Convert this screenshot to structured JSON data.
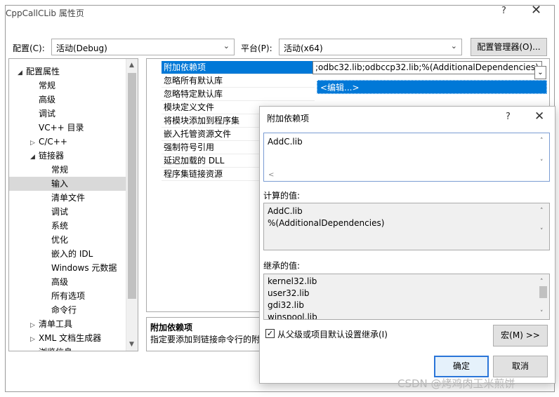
{
  "window": {
    "title": "CppCallCLib 属性页",
    "help": "?",
    "close": "✕"
  },
  "toolbar": {
    "config_label": "配置(C):",
    "config_value": "活动(Debug)",
    "platform_label": "平台(P):",
    "platform_value": "活动(x64)",
    "config_manager": "配置管理器(O)..."
  },
  "tree": {
    "items": [
      {
        "label": "配置属性",
        "arrow": "◢"
      },
      {
        "label": "常规"
      },
      {
        "label": "高级"
      },
      {
        "label": "调试"
      },
      {
        "label": "VC++ 目录"
      },
      {
        "label": "C/C++",
        "arrow": "▷"
      },
      {
        "label": "链接器",
        "arrow": "◢"
      },
      {
        "label": "常规"
      },
      {
        "label": "输入"
      },
      {
        "label": "清单文件"
      },
      {
        "label": "调试"
      },
      {
        "label": "系统"
      },
      {
        "label": "优化"
      },
      {
        "label": "嵌入的 IDL"
      },
      {
        "label": "Windows 元数据"
      },
      {
        "label": "高级"
      },
      {
        "label": "所有选项"
      },
      {
        "label": "命令行"
      },
      {
        "label": "清单工具",
        "arrow": "▷"
      },
      {
        "label": "XML 文档生成器",
        "arrow": "▷"
      },
      {
        "label": "浏览信息",
        "arrow": "▷"
      }
    ]
  },
  "grid": {
    "rows": [
      "附加依赖项",
      "忽略所有默认库",
      "忽略特定默认库",
      "模块定义文件",
      "将模块添加到程序集",
      "嵌入托管资源文件",
      "强制符号引用",
      "延迟加载的 DLL",
      "程序集链接资源"
    ],
    "value": ";odbc32.lib;odbccp32.lib;%(AdditionalDependencies)",
    "edit_option": "<编辑...>"
  },
  "description": {
    "title": "附加依赖项",
    "text": "指定要添加到链接命令行的附"
  },
  "dialog": {
    "title": "附加依赖项",
    "help": "?",
    "close": "✕",
    "input_value": "AddC.lib",
    "computed_label": "计算的值:",
    "computed_lines": [
      "AddC.lib",
      "%(AdditionalDependencies)"
    ],
    "inherited_label": "继承的值:",
    "inherited_lines": [
      "kernel32.lib",
      "user32.lib",
      "gdi32.lib",
      "winspool.lib"
    ],
    "inherit_checkbox": "从父级或项目默认设置继承(I)",
    "macro_button": "宏(M) >>",
    "ok": "确定",
    "cancel": "取消"
  },
  "watermark": "CSDN @烤鸡肉玉米煎饼"
}
